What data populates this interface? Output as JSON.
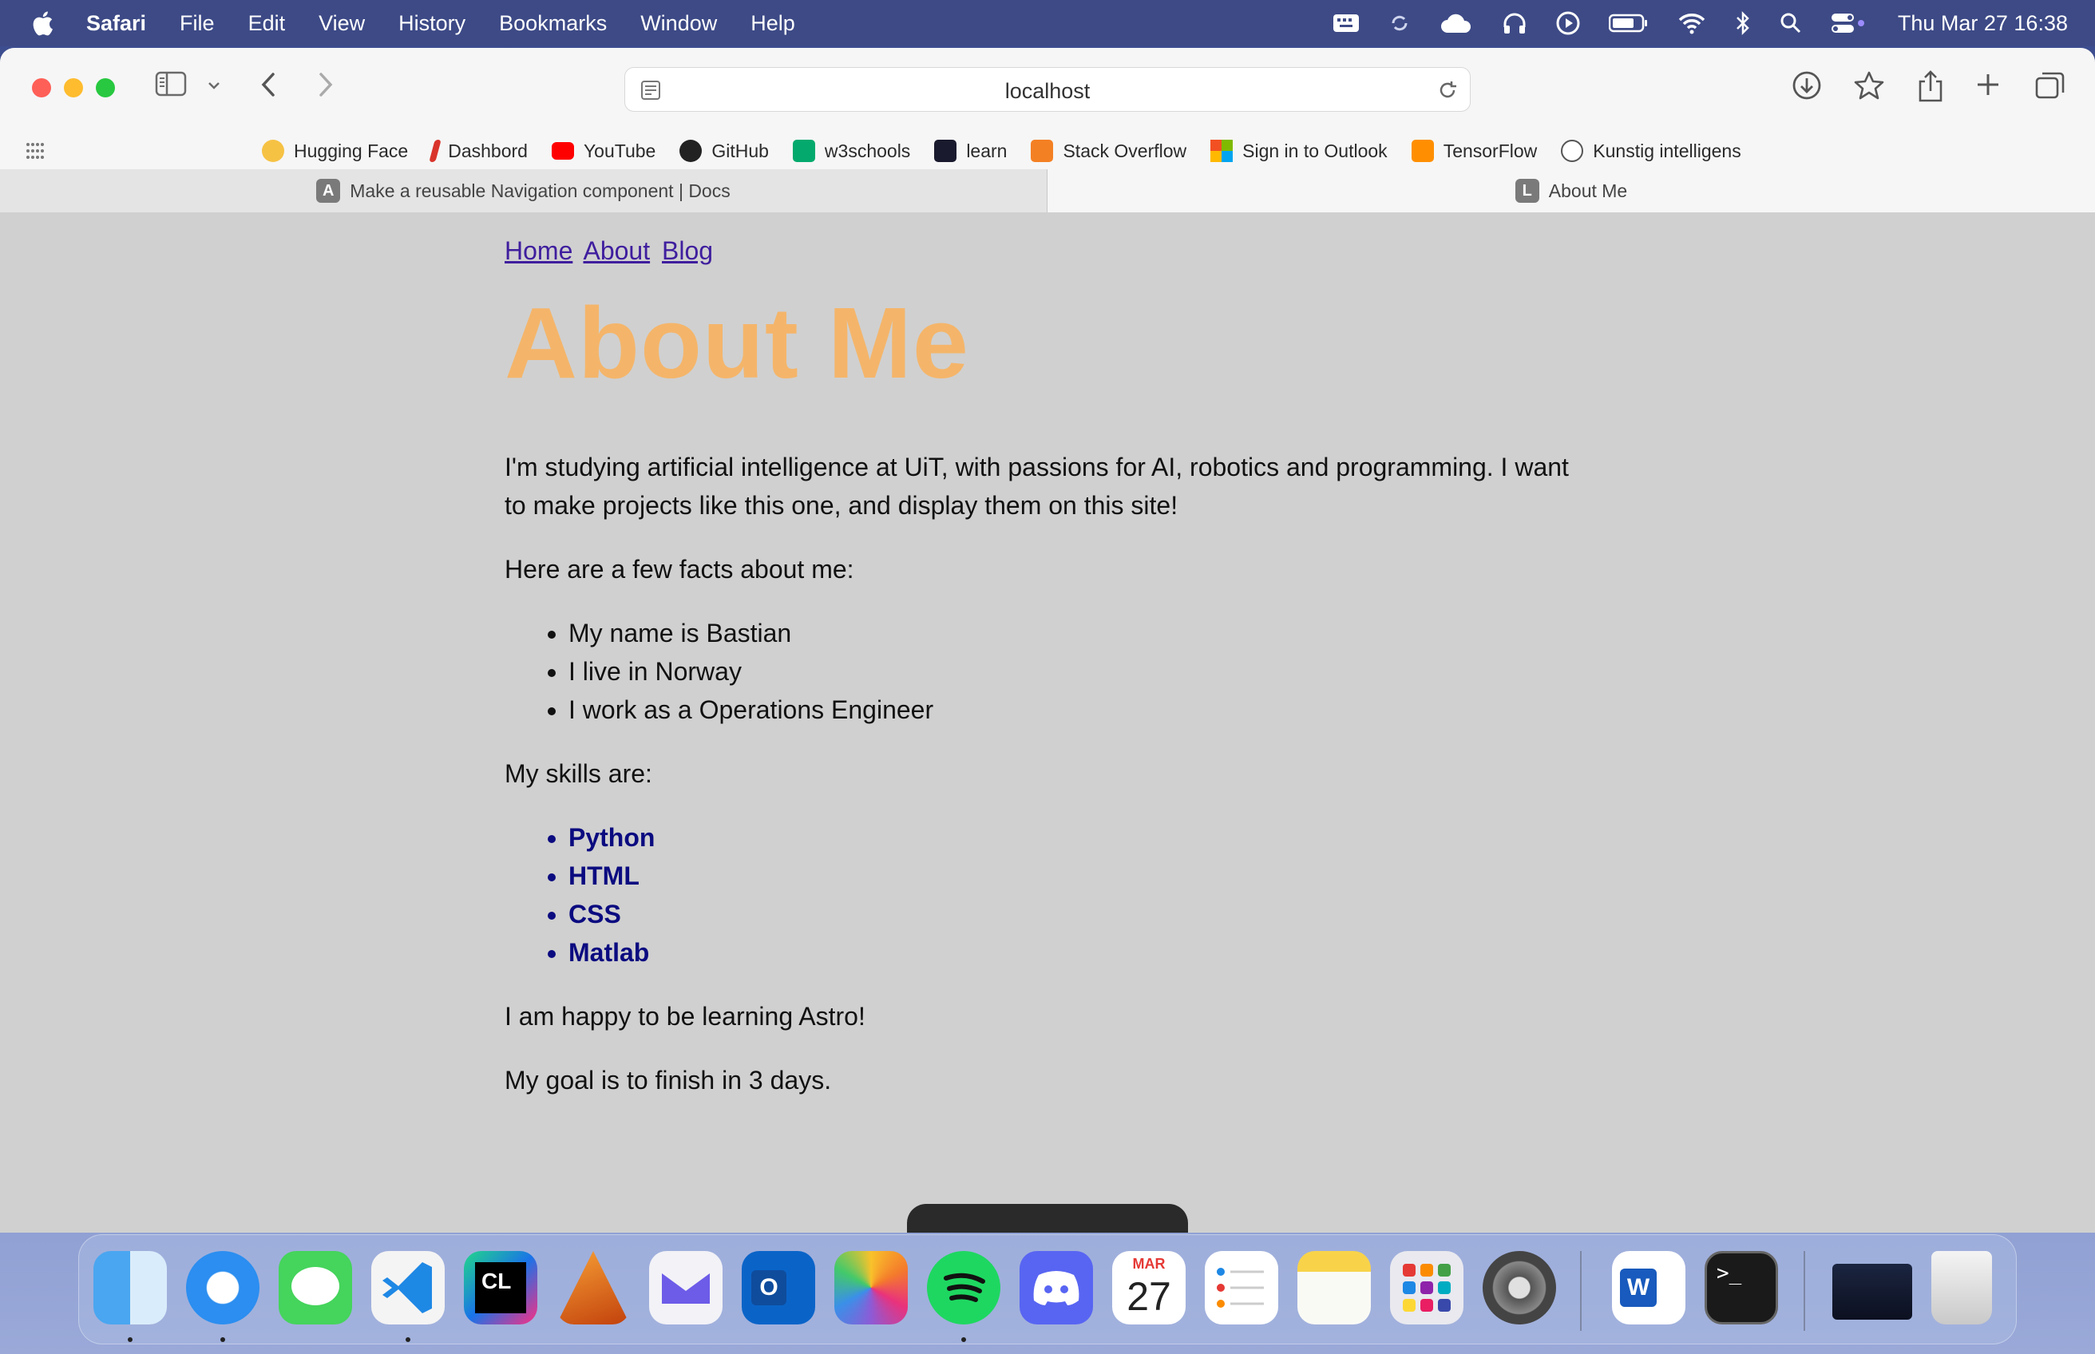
{
  "menubar": {
    "app_name": "Safari",
    "items": [
      "File",
      "Edit",
      "View",
      "History",
      "Bookmarks",
      "Window",
      "Help"
    ],
    "clock": "Thu Mar 27  16:38"
  },
  "browser": {
    "address": "localhost",
    "bookmarks": [
      {
        "label": "Hugging Face",
        "color": "#f6c244"
      },
      {
        "label": "Dashbord",
        "color": "#d9342b"
      },
      {
        "label": "YouTube",
        "color": "#ff0000"
      },
      {
        "label": "GitHub",
        "color": "#222222"
      },
      {
        "label": "w3schools",
        "color": "#04aa6d"
      },
      {
        "label": "learn",
        "color": "#1a1a2e"
      },
      {
        "label": "Stack Overflow",
        "color": "#f48024"
      },
      {
        "label": "Sign in to Outlook",
        "color": "#0078d4"
      },
      {
        "label": "TensorFlow",
        "color": "#ff8f00"
      },
      {
        "label": "Kunstig intelligens",
        "color": "#555555"
      }
    ],
    "tabs": [
      {
        "label": "Make a reusable Navigation component | Docs",
        "icon_letter": "A",
        "active": false
      },
      {
        "label": "About Me",
        "icon_letter": "L",
        "active": true
      }
    ]
  },
  "page": {
    "nav": [
      "Home",
      "About",
      "Blog"
    ],
    "title": "About Me",
    "intro": "I'm studying artificial intelligence at UiT, with passions for AI, robotics and programming. I want to make projects like this one, and display them on this site!",
    "facts_heading": "Here are a few facts about me:",
    "facts": [
      "My name is Bastian",
      "I live in Norway",
      "I work as a Operations Engineer"
    ],
    "skills_heading": "My skills are:",
    "skills": [
      "Python",
      "HTML",
      "CSS",
      "Matlab"
    ],
    "closing_1": "I am happy to be learning Astro!",
    "closing_2": "My goal is to finish in 3 days.",
    "title_color": "#f4b56a",
    "skills_color": "#0b0b80",
    "link_color": "#3f1e9e"
  },
  "dock": {
    "calendar_month": "MAR",
    "calendar_day": "27",
    "apps": [
      "finder",
      "safari",
      "messages",
      "vscode",
      "clion",
      "matlab",
      "mail-client",
      "outlook",
      "photos",
      "spotify",
      "discord",
      "calendar",
      "reminders",
      "notes",
      "launchpad",
      "system-settings",
      "word",
      "terminal",
      "window-preview",
      "trash"
    ]
  }
}
